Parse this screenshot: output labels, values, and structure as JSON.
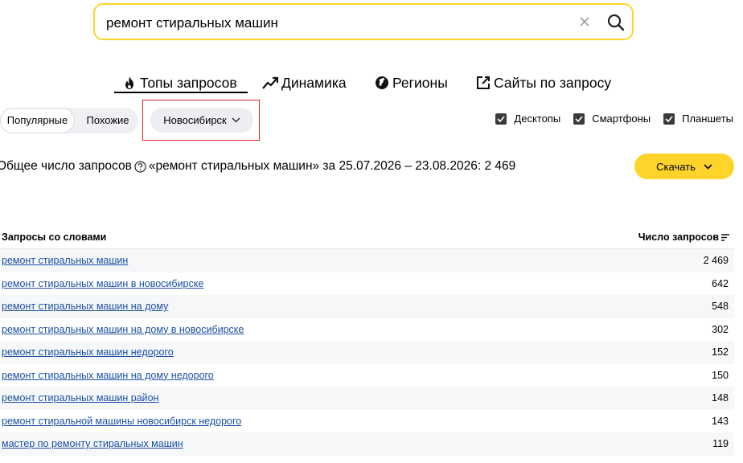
{
  "search": {
    "value": "ремонт стиральных машин"
  },
  "tabs": [
    {
      "label": "Топы запросов",
      "icon": "fire-icon",
      "active": true
    },
    {
      "label": "Динамика",
      "icon": "trend-icon"
    },
    {
      "label": "Регионы",
      "icon": "globe-icon"
    },
    {
      "label": "Сайты по запросу",
      "icon": "external-link-icon"
    }
  ],
  "mode": {
    "popular": "Популярные",
    "similar": "Похожие",
    "selected": "Популярные"
  },
  "region": {
    "label": "Новосибирск"
  },
  "devices": [
    {
      "label": "Десктопы",
      "checked": true
    },
    {
      "label": "Смартфоны",
      "checked": true
    },
    {
      "label": "Планшеты",
      "checked": true
    }
  ],
  "summary": {
    "prefix": "Общее число запросов",
    "query": "«ремонт стиральных машин» за 25.07.2026 – 23.08.2026: 2 469"
  },
  "download_label": "Скачать",
  "table": {
    "col_query": "Запросы со словами",
    "col_count": "Число запросов",
    "rows": [
      {
        "query": "ремонт стиральных машин",
        "count": "2 469"
      },
      {
        "query": "ремонт стиральных машин в новосибирске",
        "count": "642"
      },
      {
        "query": "ремонт стиральных машин на дому",
        "count": "548"
      },
      {
        "query": "ремонт стиральных машин на дому в новосибирске",
        "count": "302"
      },
      {
        "query": "ремонт стиральных машин недорого",
        "count": "152"
      },
      {
        "query": "ремонт стиральных машин на дому недорого",
        "count": "150"
      },
      {
        "query": "ремонт стиральных машин район",
        "count": "148"
      },
      {
        "query": "ремонт стиральной машины новосибирск недорого",
        "count": "143"
      },
      {
        "query": "мастер по ремонту стиральных машин",
        "count": "119"
      }
    ]
  },
  "colors": {
    "accent": "#fed42b",
    "link": "#1a4fa3",
    "highlight": "#e02020"
  }
}
